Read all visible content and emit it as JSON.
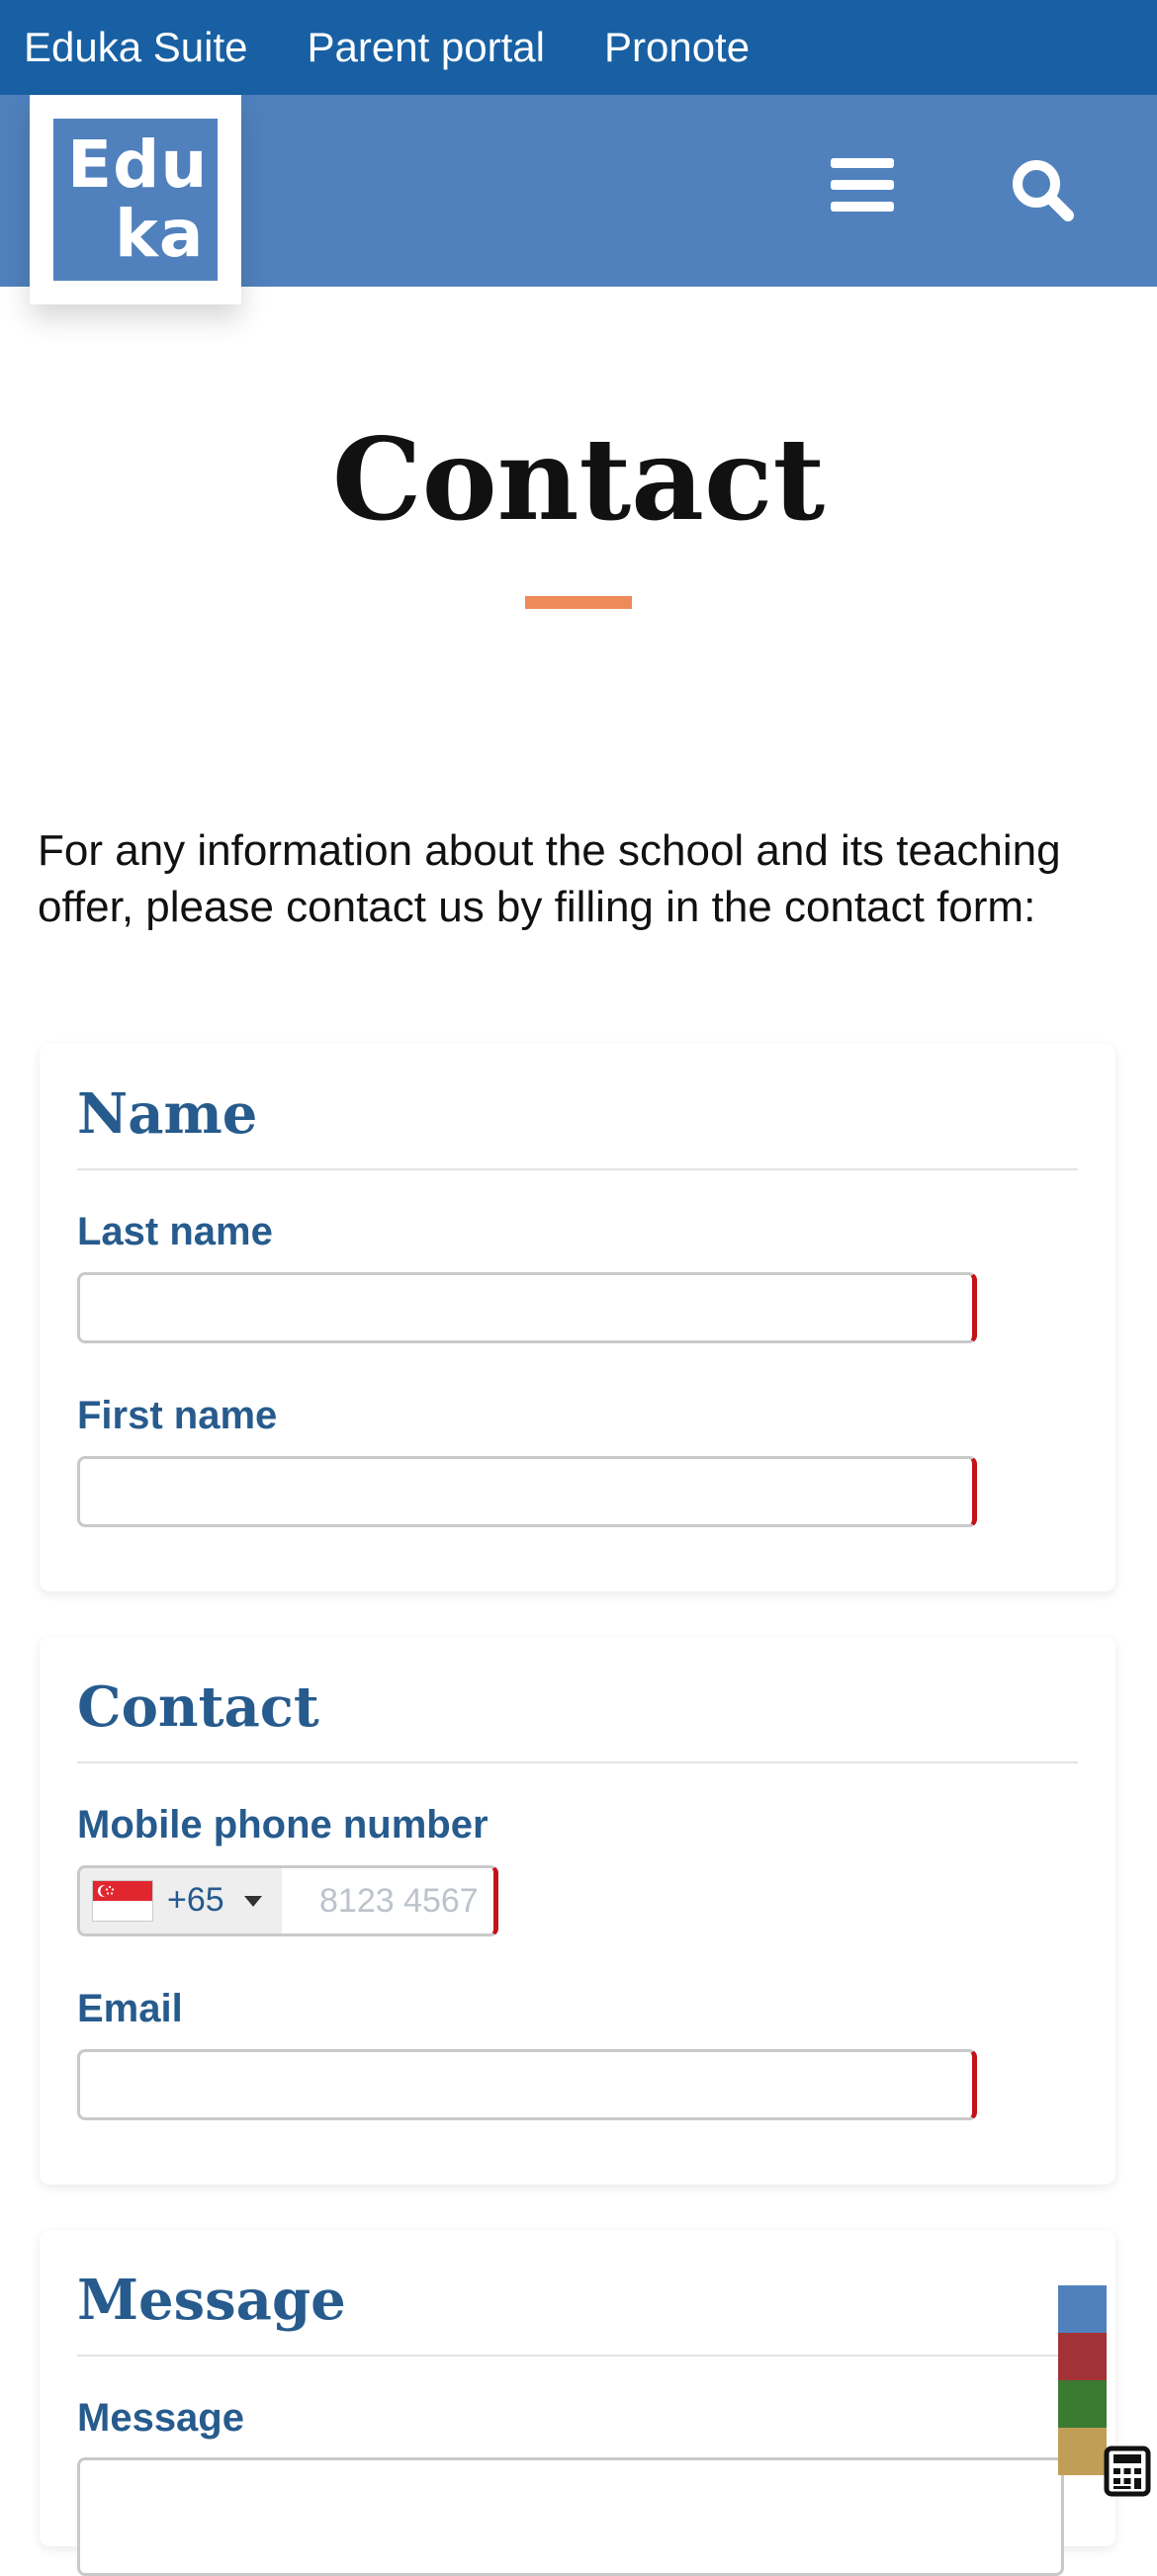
{
  "top_bar": {
    "links": [
      "Eduka Suite",
      "Parent portal",
      "Pronote"
    ]
  },
  "header": {
    "logo": {
      "line1": "Edu",
      "line2": "ka"
    },
    "menu_icon": "hamburger-menu-icon",
    "search_icon": "search-icon"
  },
  "page": {
    "title": "Contact",
    "intro": "For any information about the school and its teaching offer, please contact us by filling in the contact form:"
  },
  "form": {
    "name_section": {
      "title": "Name",
      "last_name_label": "Last name",
      "last_name_value": "",
      "first_name_label": "First name",
      "first_name_value": ""
    },
    "contact_section": {
      "title": "Contact",
      "phone_label": "Mobile phone number",
      "country_flag": "singapore-flag-icon",
      "dial_code": "+65",
      "phone_placeholder": "8123 4567",
      "email_label": "Email",
      "email_value": ""
    },
    "message_section": {
      "title": "Message",
      "message_label": "Message"
    }
  },
  "colors": {
    "top_bar": "#1860a3",
    "header": "#5081bd",
    "heading_blue": "#275b8d",
    "accent_orange": "#ed8a59",
    "required_red": "#c4121a",
    "swatches": [
      "#5081bd",
      "#a33237",
      "#3a7a31",
      "#c19e55"
    ]
  },
  "widgets": {
    "calculator_icon": "calculator-icon"
  }
}
